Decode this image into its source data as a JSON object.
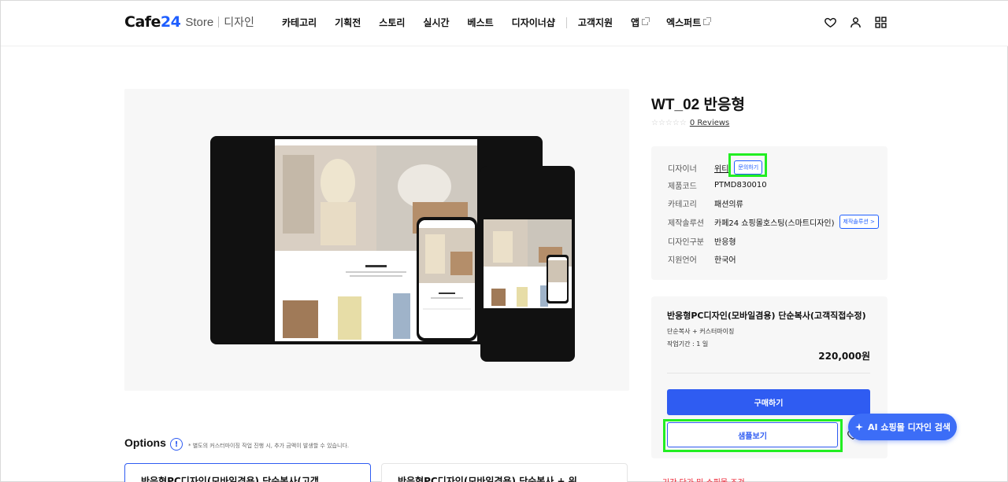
{
  "header": {
    "logo_main": "Cafe",
    "logo_num": "24",
    "logo_store": "Store",
    "logo_sub": "디자인",
    "nav": [
      {
        "label": "카테고리"
      },
      {
        "label": "기획전"
      },
      {
        "label": "스토리"
      },
      {
        "label": "실시간"
      },
      {
        "label": "베스트"
      },
      {
        "label": "디자이너샵"
      },
      {
        "label": "고객지원"
      },
      {
        "label": "앱"
      },
      {
        "label": "엑스퍼트"
      }
    ]
  },
  "product": {
    "title": "WT_02 반응형",
    "stars": "☆☆☆☆☆",
    "reviews": "0 Reviews"
  },
  "spec": {
    "rows": [
      {
        "label": "디자이너",
        "value": "위티"
      },
      {
        "label": "제품코드",
        "value": "PTMD830010"
      },
      {
        "label": "카테고리",
        "value": "패션의류"
      },
      {
        "label": "제작솔루션",
        "value": "카페24 쇼핑몰호스팅(스마트디자인)"
      },
      {
        "label": "디자인구분",
        "value": "반응형"
      },
      {
        "label": "지원언어",
        "value": "한국어"
      }
    ],
    "inquiry_chip": "문의하기",
    "solution_chip": "제작솔루션 >"
  },
  "purchase": {
    "option_title": "반응형PC디자인(모바일겸용) 단순복사(고객직접수정)",
    "option_sub1": "단순복사 + 커스터마이징",
    "option_sub2": "작업기간 : 1 일",
    "price": "220,000원",
    "buy_label": "구매하기",
    "sample_label": "샘플보기"
  },
  "ai_button": {
    "label": "AI 쇼핑몰 디자인 검색"
  },
  "notice_red": "기간 단가 및 쇼핑몰 조건",
  "options": {
    "title": "Options",
    "note": "* 별도의 커스터마이징 작업 진행 시, 추가 금액이 발생할 수 있습니다.",
    "cards": [
      {
        "label": "반응형PC디자인(모바일겸용) 단순복사(고객"
      },
      {
        "label": "반응형PC디자인(모바일겸용) 단순복사 + 워"
      }
    ]
  },
  "colors": {
    "accent": "#2f5cf2",
    "highlight": "#22ee22",
    "panel_bg": "#f7f7f7"
  }
}
